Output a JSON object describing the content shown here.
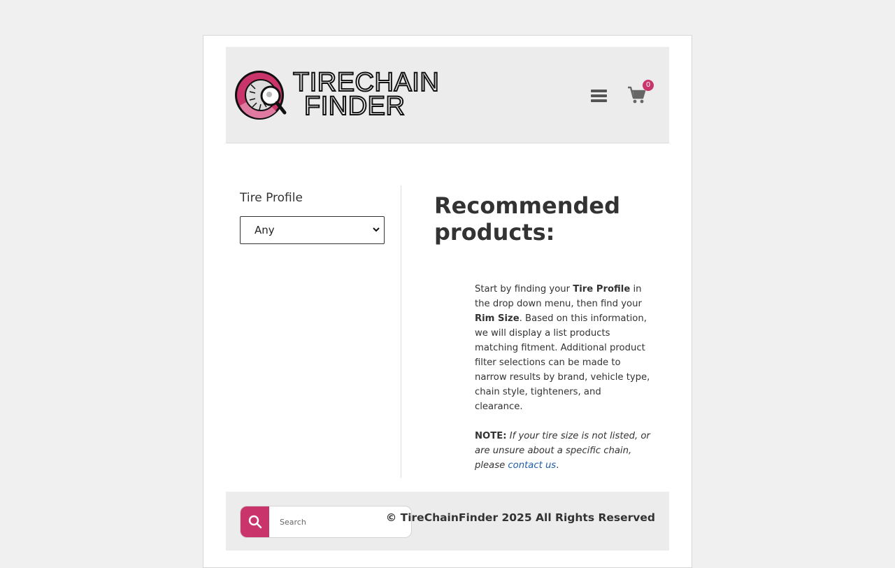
{
  "header": {
    "logo_line1": "TIRECHAIN",
    "logo_line2": "FINDER",
    "cart_count": "0"
  },
  "sidebar": {
    "title": "Tire Profile",
    "select_value": "Any"
  },
  "main": {
    "heading": "Recommended products:",
    "p1_start": "Start by finding your ",
    "p1_bold1": "Tire Profile",
    "p1_mid": " in the drop down menu, then find your ",
    "p1_bold2": "Rim Size",
    "p1_end": ". Based on this information, we will display a list products matching fitment. Additional product filter selections can be made to narrow results by brand, vehicle type, chain style, tighteners, and clearance.",
    "note_label": "NOTE:",
    "note_text": " If your tire size is not listed, or are unsure about a specific chain, please ",
    "note_link": "contact us",
    "note_end": "."
  },
  "footer": {
    "search_placeholder": "Search",
    "copyright": "© TireChainFinder 2025 All Rights Reserved"
  },
  "icons": {
    "menu": "hamburger-icon",
    "cart": "cart-icon",
    "search": "search-icon"
  },
  "colors": {
    "accent": "#c9356b",
    "link": "#1f5da8",
    "header_bg": "#ececec"
  }
}
